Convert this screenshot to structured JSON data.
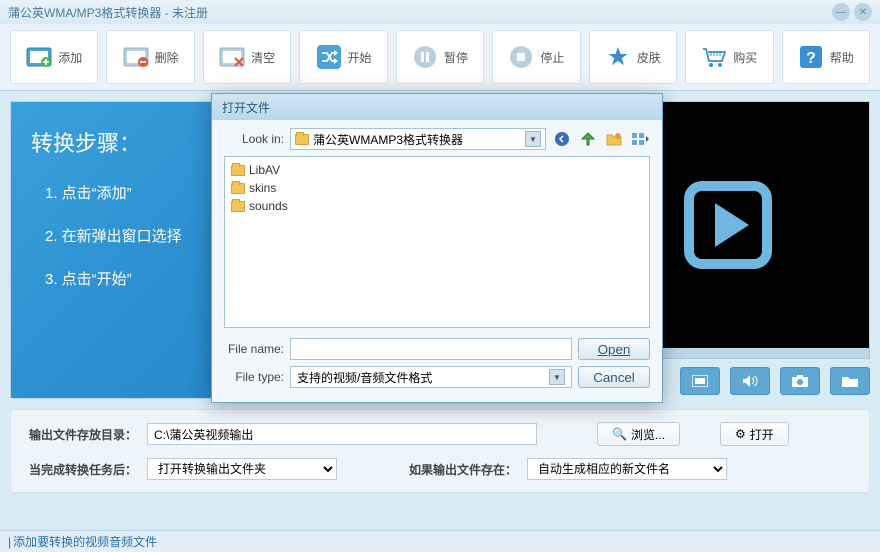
{
  "titlebar": {
    "title": "蒲公英WMA/MP3格式转换器 - 未注册"
  },
  "toolbar": {
    "add": "添加",
    "delete": "删除",
    "clear": "清空",
    "start": "开始",
    "pause": "暂停",
    "stop": "停止",
    "skin": "皮肤",
    "buy": "购买",
    "help": "帮助"
  },
  "steps": {
    "heading": "转换步骤：",
    "s1": "1. 点击“添加”",
    "s2": "2. 在新弹出窗口选择",
    "s3": "3. 点击“开始”"
  },
  "bottom": {
    "output_dir_label": "输出文件存放目录：",
    "output_dir_value": "C:\\蒲公英视频输出",
    "browse": "浏览...",
    "open": "打开",
    "after_label": "当完成转换任务后：",
    "after_value": "打开转换输出文件夹",
    "exists_label": "如果输出文件存在：",
    "exists_value": "自动生成相应的新文件名"
  },
  "statusbar": {
    "text": "添加要转换的视频音频文件"
  },
  "dialog": {
    "title": "打开文件",
    "lookin_label": "Look in:",
    "lookin_value": "蒲公英WMAMP3格式转换器",
    "items": {
      "i0": "LibAV",
      "i1": "skins",
      "i2": "sounds"
    },
    "filename_label": "File name:",
    "filename_value": "",
    "filetype_label": "File type:",
    "filetype_value": "支持的视频/音频文件格式",
    "open_btn": "Open",
    "cancel_btn": "Cancel"
  }
}
